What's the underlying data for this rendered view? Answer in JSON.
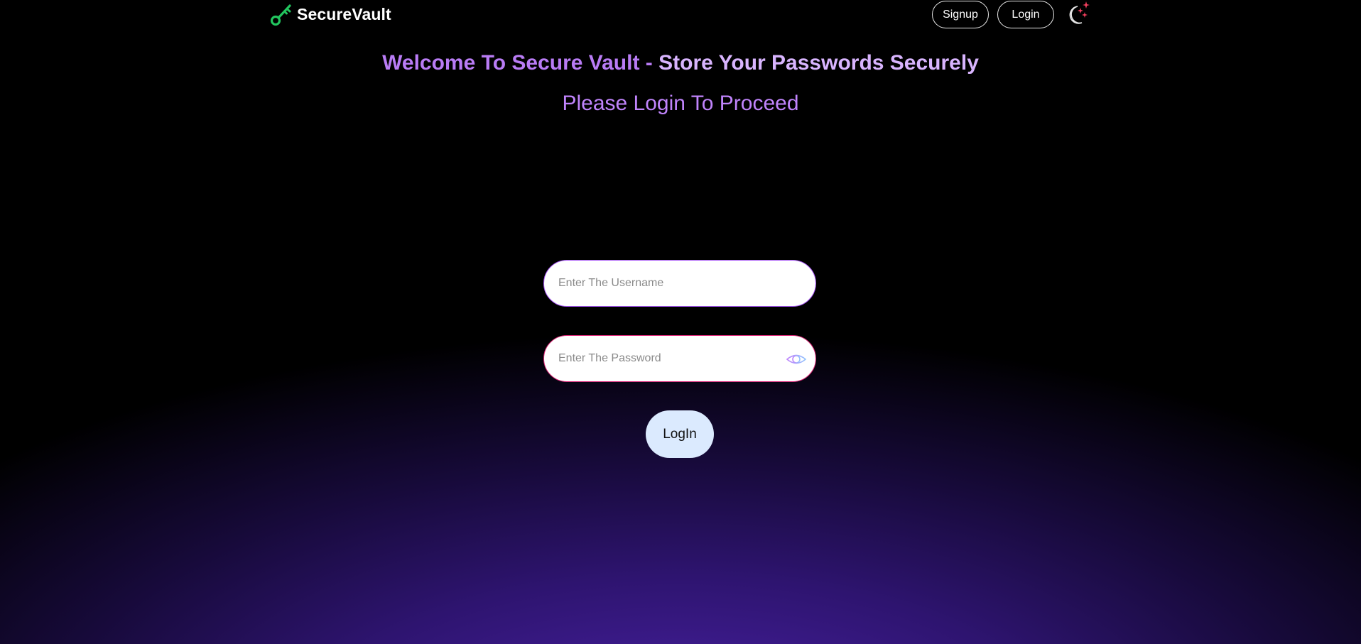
{
  "app": {
    "brand": "SecureVault"
  },
  "nav": {
    "signup_label": "Signup",
    "login_label": "Login",
    "theme_icon": "moon-stars-icon"
  },
  "hero": {
    "title_part1": "Welcome To Secure Vault - ",
    "title_part2": "Store Your Passwords Securely",
    "subtitle": "Please Login To Proceed"
  },
  "form": {
    "username_placeholder": "Enter The Username",
    "username_value": "",
    "password_placeholder": "Enter The Password",
    "password_value": "",
    "submit_label": "LogIn",
    "eye_icon": "eye-icon"
  },
  "colors": {
    "brand_key": "#22c55e",
    "title_primary": "#b97cf5",
    "title_secondary": "#d8b4fe",
    "subtitle": "#c084fc",
    "username_border": "#a855f7",
    "password_border": "#db2777",
    "submit_bg": "#dbeafe",
    "background_glow": "#4b22a8"
  }
}
